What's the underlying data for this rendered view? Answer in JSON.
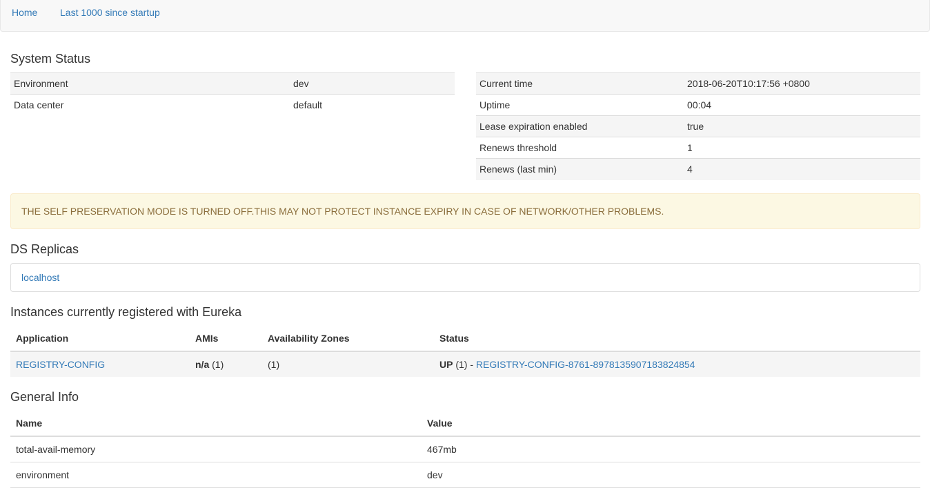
{
  "nav": {
    "home": "Home",
    "last1000": "Last 1000 since startup"
  },
  "system_status": {
    "title": "System Status",
    "left": [
      {
        "key": "Environment",
        "value": "dev"
      },
      {
        "key": "Data center",
        "value": "default"
      }
    ],
    "right": [
      {
        "key": "Current time",
        "value": "2018-06-20T10:17:56 +0800"
      },
      {
        "key": "Uptime",
        "value": "00:04"
      },
      {
        "key": "Lease expiration enabled",
        "value": "true"
      },
      {
        "key": "Renews threshold",
        "value": "1"
      },
      {
        "key": "Renews (last min)",
        "value": "4"
      }
    ]
  },
  "alert": {
    "text": "THE SELF PRESERVATION MODE IS TURNED OFF.THIS MAY NOT PROTECT INSTANCE EXPIRY IN CASE OF NETWORK/OTHER PROBLEMS."
  },
  "replicas": {
    "title": "DS Replicas",
    "items": [
      "localhost"
    ]
  },
  "instances": {
    "title": "Instances currently registered with Eureka",
    "headers": [
      "Application",
      "AMIs",
      "Availability Zones",
      "Status"
    ],
    "rows": [
      {
        "application": "REGISTRY-CONFIG",
        "ami_bold": "n/a",
        "ami_count": " (1)",
        "zones": "(1)",
        "status_bold": "UP",
        "status_count": " (1) - ",
        "status_link": "REGISTRY-CONFIG-8761-8978135907183824854"
      }
    ]
  },
  "general_info": {
    "title": "General Info",
    "headers": [
      "Name",
      "Value"
    ],
    "rows": [
      {
        "name": "total-avail-memory",
        "value": "467mb"
      },
      {
        "name": "environment",
        "value": "dev"
      }
    ]
  },
  "colors": {
    "link": "#337ab7",
    "alert_bg": "#fcf8e3",
    "alert_text": "#8a6d3b",
    "stripe": "#f5f5f5"
  }
}
